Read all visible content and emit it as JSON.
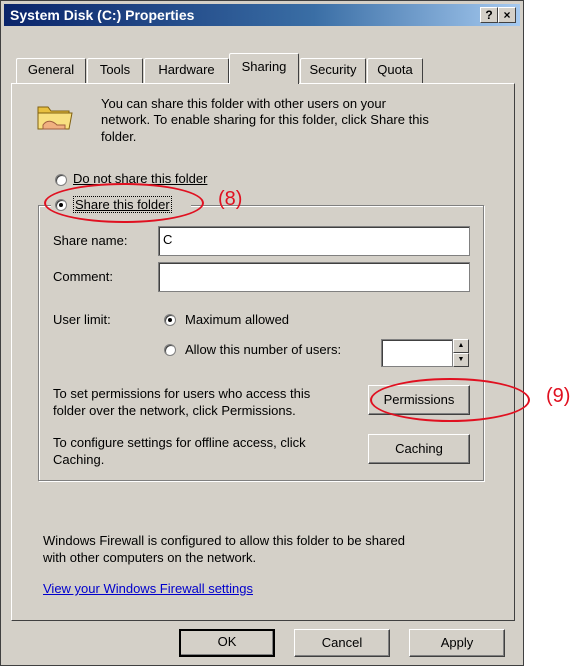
{
  "window": {
    "title": "System Disk (C:) Properties",
    "help_btn": "?",
    "close_btn": "×"
  },
  "tabs": [
    {
      "label": "General",
      "active": false
    },
    {
      "label": "Tools",
      "active": false
    },
    {
      "label": "Hardware",
      "active": false
    },
    {
      "label": "Sharing",
      "active": true
    },
    {
      "label": "Security",
      "active": false
    },
    {
      "label": "Quota",
      "active": false
    }
  ],
  "sharing": {
    "intro_line1": "You can share this folder with other users on your",
    "intro_line2": "network.  To enable sharing for this folder, click Share this",
    "intro_line3": "folder.",
    "do_not_share_label": "Do not share this folder",
    "share_label": "Share this folder",
    "selected_option": "Share this folder",
    "share_name_label": "Share name:",
    "share_name_value": "C",
    "comment_label": "Comment:",
    "comment_value": "",
    "user_limit_label": "User limit:",
    "max_allowed_label": "Maximum allowed",
    "allow_users_label": "Allow this number of users:",
    "user_limit_selected": "Maximum allowed",
    "users_count_value": "",
    "permissions_text_line1": "To set permissions for users who access this",
    "permissions_text_line2": "folder over the network, click Permissions.",
    "permissions_button": "Permissions",
    "caching_text_line1": "To configure settings for offline access, click",
    "caching_text_line2": "Caching.",
    "caching_button": "Caching",
    "firewall_line1": "Windows Firewall is configured to allow this folder to be shared",
    "firewall_line2": "with other computers on the network.",
    "firewall_link": "View your Windows Firewall settings"
  },
  "footer": {
    "ok": "OK",
    "cancel": "Cancel",
    "apply": "Apply"
  },
  "annotations": {
    "label_8": "(8)",
    "label_9": "(9)"
  },
  "colors": {
    "title_bar": "#0a246a",
    "dialog_face": "#d4d0c8",
    "link": "#0000cc",
    "annotation": "#e01020"
  },
  "icons": {
    "folder": "shared-folder-icon",
    "spin_up": "spin-up-icon",
    "spin_down": "spin-down-icon"
  }
}
